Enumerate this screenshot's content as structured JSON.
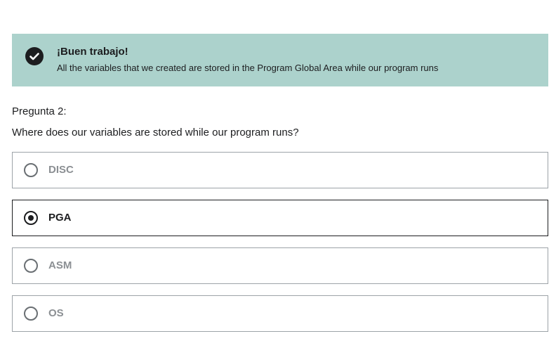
{
  "banner": {
    "icon": "check-circle-icon",
    "title": "¡Buen trabajo!",
    "message": "All the variables that we created are stored in the Program Global Area while our program runs",
    "background_color": "#acd2cc"
  },
  "question": {
    "number_label": "Pregunta 2:",
    "text": "Where does our variables are stored while our program runs?"
  },
  "options": [
    {
      "label": "DISC",
      "selected": false
    },
    {
      "label": "PGA",
      "selected": true
    },
    {
      "label": "ASM",
      "selected": false
    },
    {
      "label": "OS",
      "selected": false
    }
  ]
}
